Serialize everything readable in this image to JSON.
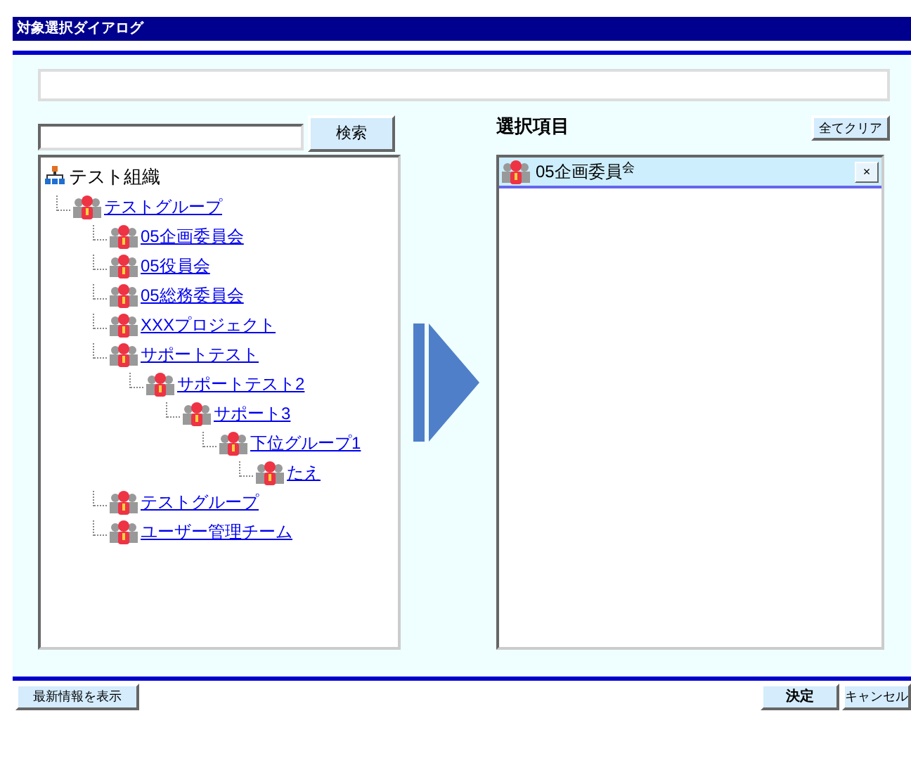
{
  "window": {
    "title": "対象選択ダイアログ"
  },
  "search": {
    "button": "検索"
  },
  "tree": {
    "label": "テスト組織",
    "children": [
      {
        "label": "テストグループ",
        "children": [
          {
            "label": "05企画委員会"
          },
          {
            "label": "05役員会"
          },
          {
            "label": "05総務委員会"
          },
          {
            "label": "XXXプロジェクト"
          },
          {
            "label": "サポートテスト",
            "children": [
              {
                "label": "サポートテスト2",
                "children": [
                  {
                    "label": "サポート3",
                    "children": [
                      {
                        "label": "下位グループ1",
                        "children": [
                          {
                            "label": "たえ"
                          }
                        ]
                      }
                    ]
                  }
                ]
              }
            ]
          },
          {
            "label": "テストグループ"
          },
          {
            "label": "ユーザー管理チーム"
          }
        ]
      }
    ]
  },
  "selected_panel": {
    "title": "選択項目",
    "clear_button": "全てクリア",
    "items": [
      {
        "label": "05企画委員$^{会}$",
        "remove": "×"
      }
    ]
  },
  "footer": {
    "refresh_button": "最新情報を表示",
    "ok_button": "決定",
    "cancel_button": "キャンセル"
  }
}
